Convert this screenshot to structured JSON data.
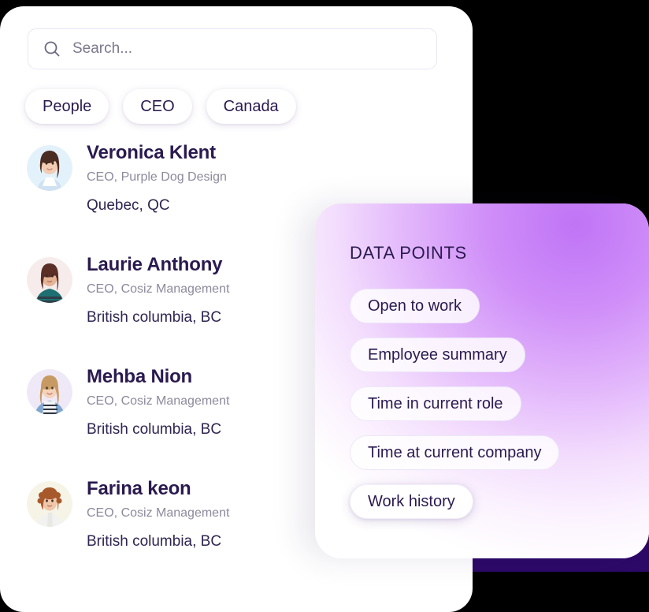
{
  "search": {
    "placeholder": "Search...",
    "value": "",
    "icon": "search-icon"
  },
  "filters": [
    {
      "label": "People"
    },
    {
      "label": "CEO"
    },
    {
      "label": "Canada"
    }
  ],
  "people": [
    {
      "name": "Veronica Klent",
      "role": "CEO, Purple Dog Design",
      "location": "Quebec, QC",
      "avatar": {
        "bg": "#e3f1fa",
        "hair": "#4a2c22",
        "top": "#bcd7ee",
        "skin": "#f2cdb4"
      }
    },
    {
      "name": "Laurie Anthony",
      "role": "CEO, Cosiz Management",
      "location": "British columbia, BC",
      "avatar": {
        "bg": "#f7ecec",
        "hair": "#5b2f26",
        "top": "#1d6f72",
        "skin": "#e4b494"
      }
    },
    {
      "name": "Mehba Nion",
      "role": "CEO, Cosiz Management",
      "location": "British columbia, BC",
      "avatar": {
        "bg": "#efe9f7",
        "hair": "#c89a63",
        "top": "#7fa7cf",
        "skin": "#f5d3bb"
      }
    },
    {
      "name": "Farina keon",
      "role": "CEO, Cosiz Management",
      "location": "British columbia, BC",
      "avatar": {
        "bg": "#f6f4e6",
        "hair": "#a8592c",
        "top": "#f2f2f0",
        "skin": "#f0c7a9"
      }
    }
  ],
  "data_points": {
    "title": "DATA POINTS",
    "chips": [
      {
        "label": "Open to work",
        "elevated": false
      },
      {
        "label": "Employee summary",
        "elevated": false
      },
      {
        "label": "Time in current role",
        "elevated": false
      },
      {
        "label": "Time at current company",
        "elevated": false
      },
      {
        "label": "Work history",
        "elevated": true
      }
    ]
  },
  "colors": {
    "accent_purple": "#c074f6",
    "dark_purple": "#2d0968",
    "text_primary": "#2a1a4f",
    "text_muted": "#8c8a9c",
    "background": "#000000"
  }
}
